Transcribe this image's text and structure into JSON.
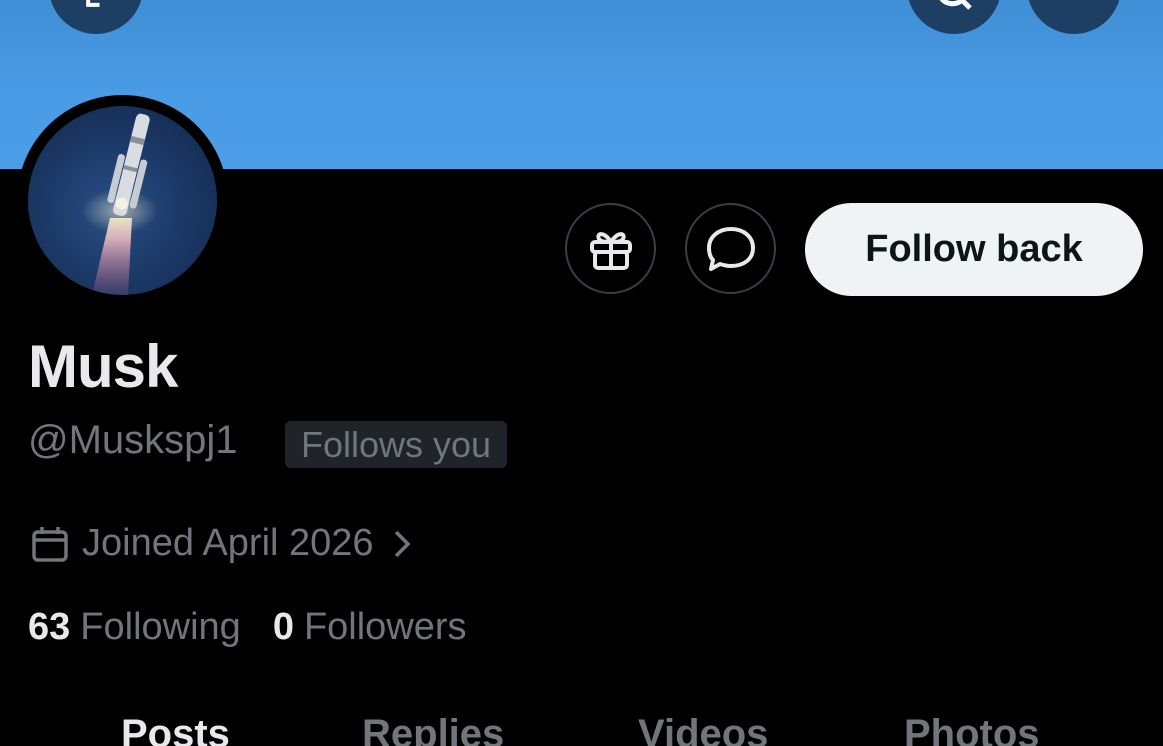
{
  "header": {
    "back_icon": "arrow-left-icon",
    "search_icon": "search-icon",
    "more_icon": "more-icon",
    "banner_color": "#4a9ce6"
  },
  "profile": {
    "avatar": "rocket-launch-avatar",
    "name": "Musk",
    "handle": "@Muskspj1",
    "follows_you_badge": "Follows you",
    "joined": "Joined April 2026",
    "following_count": "63",
    "following_label": "Following",
    "followers_count": "0",
    "followers_label": "Followers"
  },
  "actions": {
    "gift_icon": "gift-icon",
    "message_icon": "message-bubble-icon",
    "follow_back_label": "Follow back"
  },
  "tabs": [
    {
      "label": "Posts",
      "active": true
    },
    {
      "label": "Replies",
      "active": false
    },
    {
      "label": "Videos",
      "active": false
    },
    {
      "label": "Photos",
      "active": false
    }
  ],
  "colors": {
    "background": "#000000",
    "primary_text": "#e7e9ea",
    "secondary_text": "#71767b",
    "button_light": "#eff3f4"
  }
}
